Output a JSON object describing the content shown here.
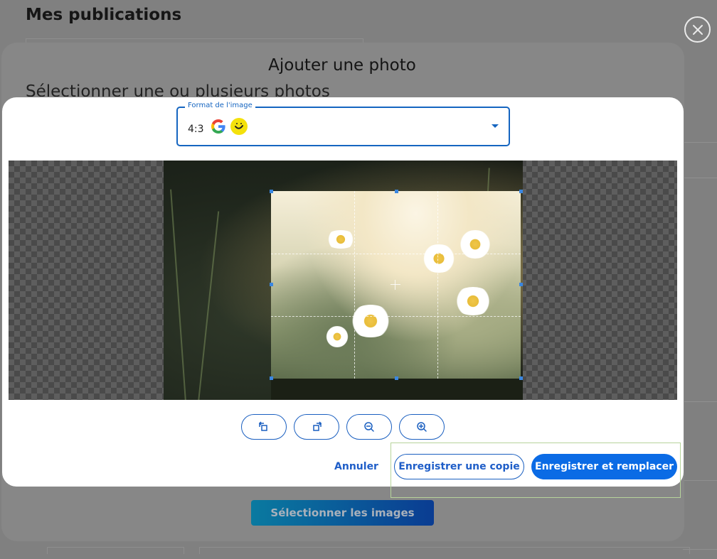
{
  "page": {
    "title": "Mes publications"
  },
  "outer_modal": {
    "title": "Ajouter une photo",
    "subtitle": "Sélectionner une ou plusieurs photos",
    "select_button_label": "Sélectionner les images"
  },
  "dialog": {
    "format_field": {
      "legend": "Format de l'image",
      "value": "4:3"
    },
    "toolbar": {
      "rotate_left": "rotate-left-icon",
      "rotate_right": "rotate-right-icon",
      "zoom_out": "zoom-out-icon",
      "zoom_in": "zoom-in-icon"
    },
    "actions": {
      "cancel_label": "Annuler",
      "save_copy_label": "Enregistrer une copie",
      "save_replace_label": "Enregistrer et remplacer"
    }
  },
  "colors": {
    "primary": "#0b6be5",
    "outline": "#1a5fc0",
    "highlight": "#b7d49b",
    "smiley": "#f4e10c"
  }
}
